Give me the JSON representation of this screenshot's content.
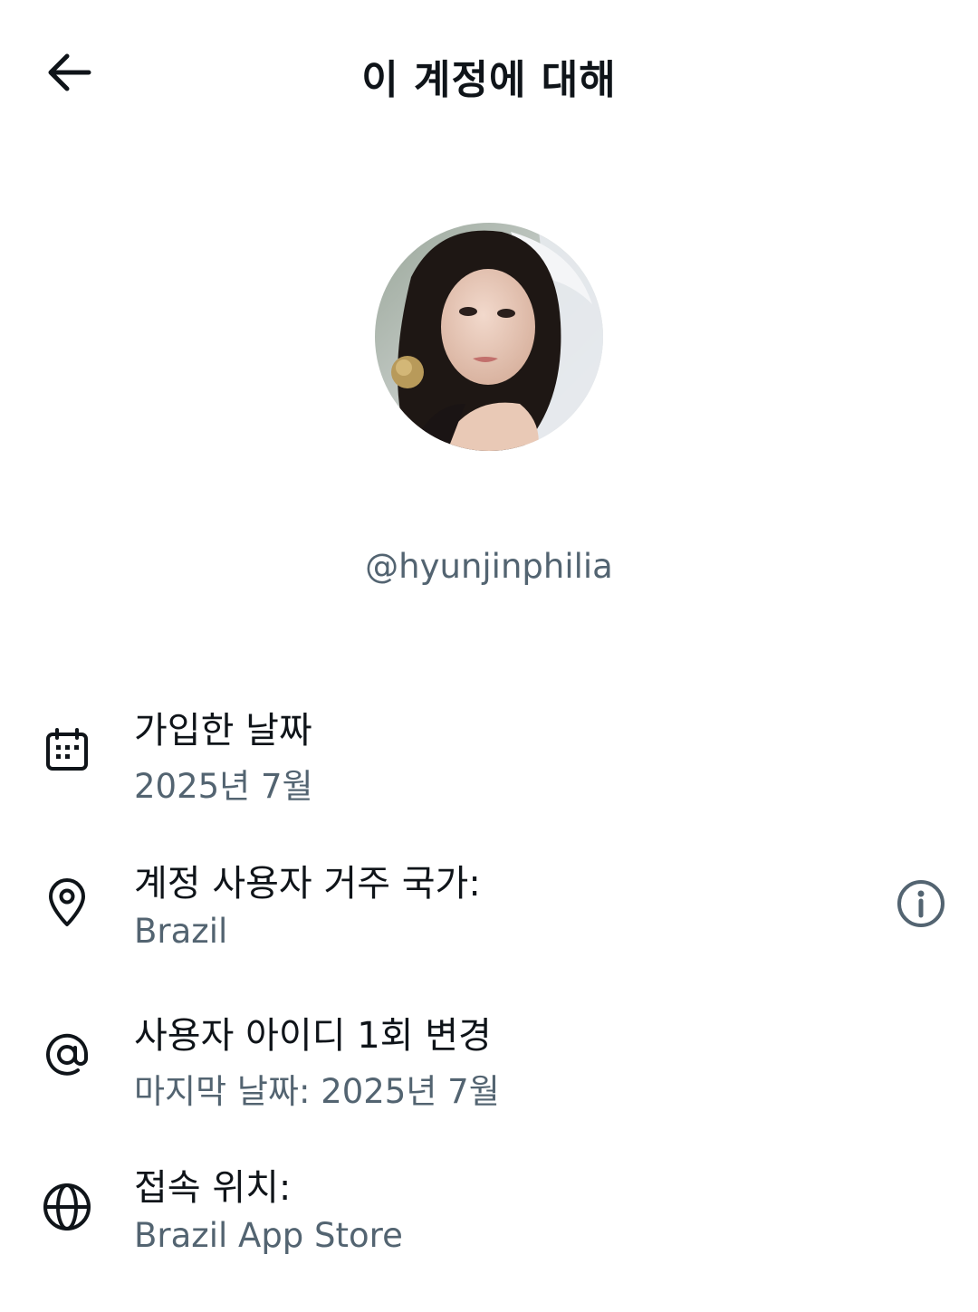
{
  "header": {
    "back_icon": "arrow-left-icon",
    "title": "이 계정에 대해"
  },
  "profile": {
    "avatar_alt": "profile photo",
    "handle": "@hyunjinphilia"
  },
  "rows": [
    {
      "icon": "calendar-icon",
      "title": "가입한 날짜",
      "subtitle": "2025년 7월"
    },
    {
      "icon": "location-pin-icon",
      "title": "계정 사용자 거주 국가:",
      "subtitle": "Brazil",
      "info_icon": "info-circle-icon"
    },
    {
      "icon": "at-sign-icon",
      "title": "사용자 아이디 1회 변경",
      "subtitle": "마지막 날짜: 2025년 7월"
    },
    {
      "icon": "globe-icon",
      "title": "접속 위치:",
      "subtitle": "Brazil App Store"
    }
  ],
  "colors": {
    "text_primary": "#0f1419",
    "text_secondary": "#536471",
    "background": "#ffffff"
  }
}
